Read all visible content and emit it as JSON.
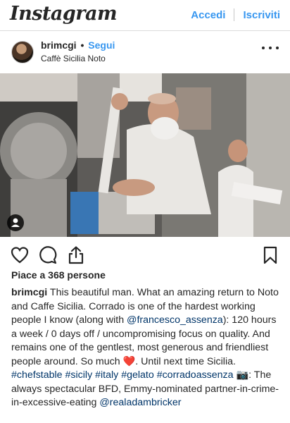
{
  "header": {
    "logo": "Instagram",
    "login": "Accedi",
    "signup": "Iscriviti"
  },
  "post": {
    "username": "brimcgi",
    "separator": "•",
    "follow": "Segui",
    "location": "Caffè Sicilia Noto",
    "likes": "Piace a 368 persone"
  },
  "icons": {
    "like": "heart-icon",
    "comment": "comment-icon",
    "share": "share-icon",
    "save": "bookmark-icon",
    "more": "more-icon",
    "tag": "user-tag-icon"
  },
  "caption": {
    "username": "brimcgi",
    "p1": " This beautiful man. What an amazing return to Noto and Caffe Sicilia. Corrado is one of the hardest working people I know (along with ",
    "mention1": "@francesco_assenza",
    "p2": "): 120 hours a week / 0 days off / uncompromising focus on quality. And remains one of the gentlest, most generous and friendliest people around. So much ",
    "heart": "❤️",
    "p3": ". Until next time Sicilia. ",
    "tag1": "#chefstable",
    "tag2": "#sicily",
    "tag3": "#italy",
    "tag4": "#gelato",
    "tag5": "#corradoassenza",
    "camera": "📷",
    "p4": ": The always spectacular BFD, Emmy-nominated partner-in-crime-in-excessive-eating ",
    "mention2": "@realadambricker"
  },
  "colors": {
    "link": "#3897f0",
    "text": "#262626",
    "heart": "#ed4956"
  }
}
